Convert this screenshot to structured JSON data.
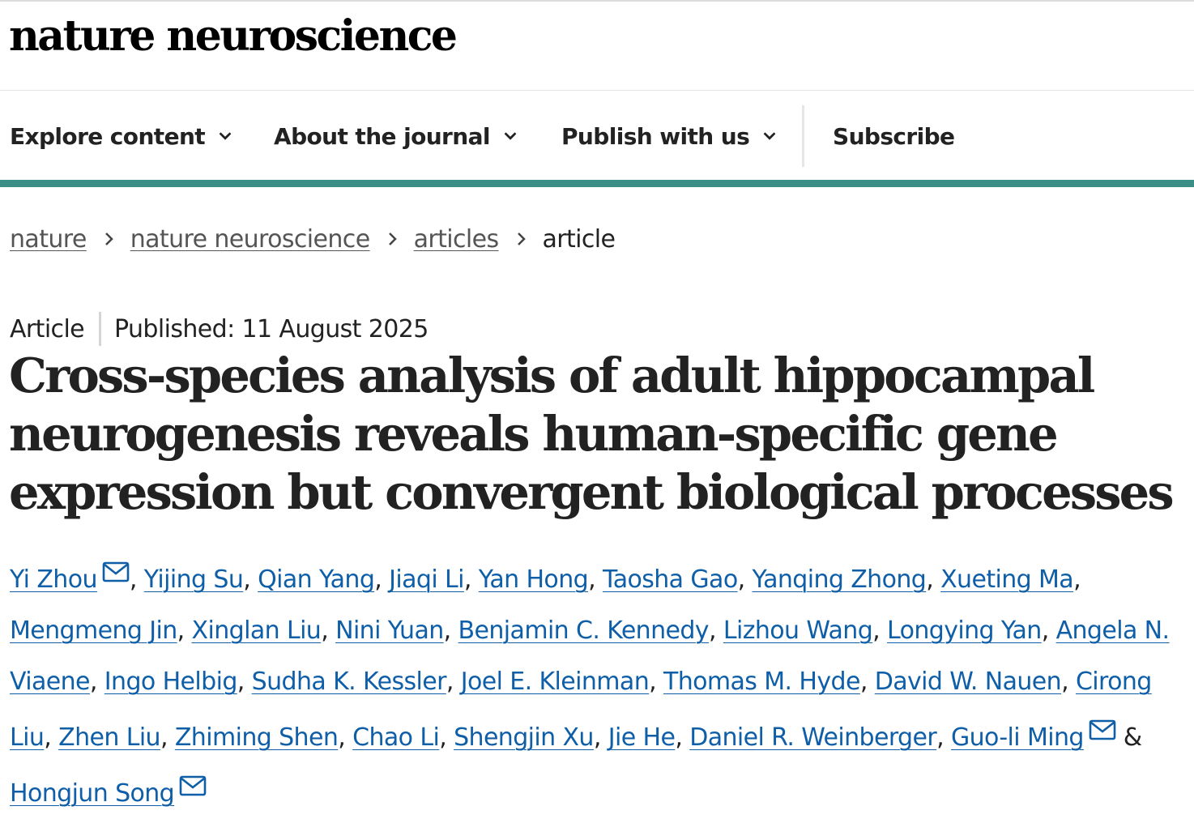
{
  "brand": {
    "logo_text": "nature neuroscience"
  },
  "nav": {
    "items": [
      {
        "label": "Explore content",
        "has_dropdown": true
      },
      {
        "label": "About the journal",
        "has_dropdown": true
      },
      {
        "label": "Publish with us",
        "has_dropdown": true
      },
      {
        "label": "Subscribe",
        "has_dropdown": false
      }
    ]
  },
  "breadcrumb": {
    "items": [
      {
        "label": "nature",
        "link": true
      },
      {
        "label": "nature neuroscience",
        "link": true
      },
      {
        "label": "articles",
        "link": true
      },
      {
        "label": "article",
        "link": false
      }
    ],
    "separator_icon": "chevron-right-icon"
  },
  "article": {
    "type": "Article",
    "published": "Published: 11 August 2025",
    "title": "Cross-species analysis of adult hippocampal neurogenesis reveals human-specific gene expression but convergent biological processes"
  },
  "authors": [
    {
      "name": "Yi Zhou",
      "corresponding": true
    },
    {
      "name": "Yijing Su"
    },
    {
      "name": "Qian Yang"
    },
    {
      "name": "Jiaqi Li"
    },
    {
      "name": "Yan Hong"
    },
    {
      "name": "Taosha Gao"
    },
    {
      "name": "Yanqing Zhong"
    },
    {
      "name": "Xueting Ma"
    },
    {
      "name": "Mengmeng Jin"
    },
    {
      "name": "Xinglan Liu"
    },
    {
      "name": "Nini Yuan"
    },
    {
      "name": "Benjamin C. Kennedy"
    },
    {
      "name": "Lizhou Wang"
    },
    {
      "name": "Longying Yan"
    },
    {
      "name": "Angela N. Viaene"
    },
    {
      "name": "Ingo Helbig"
    },
    {
      "name": "Sudha K. Kessler"
    },
    {
      "name": "Joel E. Kleinman"
    },
    {
      "name": "Thomas M. Hyde"
    },
    {
      "name": "David W. Nauen"
    },
    {
      "name": "Cirong Liu"
    },
    {
      "name": "Zhen Liu"
    },
    {
      "name": "Zhiming Shen"
    },
    {
      "name": "Chao Li"
    },
    {
      "name": "Shengjin Xu"
    },
    {
      "name": "Jie He"
    },
    {
      "name": "Daniel R. Weinberger"
    },
    {
      "name": "Guo-li Ming",
      "corresponding": true
    },
    {
      "name": "Hongjun Song",
      "corresponding": true
    }
  ],
  "author_separators": {
    "comma": ", ",
    "last": " & "
  },
  "icons": {
    "dropdown": "chevron-down-icon",
    "email": "mail-icon"
  },
  "colors": {
    "accent_bar": "#3c8f86",
    "link": "#0e5ea8",
    "text": "#222222"
  }
}
